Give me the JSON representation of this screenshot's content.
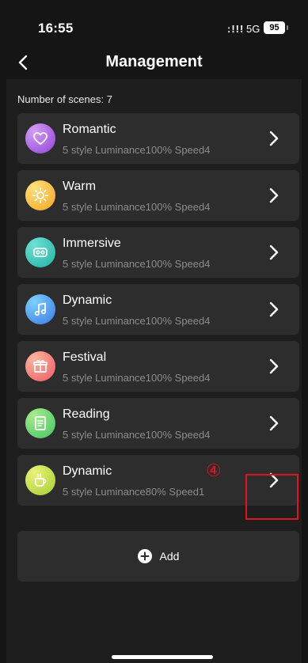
{
  "status_bar": {
    "time": "16:55",
    "signal": ":!!!",
    "network": "5G",
    "battery": "95"
  },
  "header": {
    "title": "Management",
    "back_icon": "chevron-left-icon"
  },
  "scene_count_label": "Number of scenes: 7",
  "scenes": [
    {
      "name": "Romantic",
      "desc": "5 style Luminance100% Speed4",
      "icon": "heart-icon",
      "colors": [
        "#d69cf5",
        "#8e44d6"
      ]
    },
    {
      "name": "Warm",
      "desc": "5 style Luminance100% Speed4",
      "icon": "sun-icon",
      "colors": [
        "#fde07a",
        "#f5a623"
      ]
    },
    {
      "name": "Immersive",
      "desc": "5 style Luminance100% Speed4",
      "icon": "vr-goggles-icon",
      "colors": [
        "#6ee0d2",
        "#1fb3a6"
      ]
    },
    {
      "name": "Dynamic",
      "desc": "5 style Luminance100% Speed4",
      "icon": "music-note-icon",
      "colors": [
        "#7cd0fb",
        "#3b78e8"
      ]
    },
    {
      "name": "Festival",
      "desc": "5 style Luminance100% Speed4",
      "icon": "gift-icon",
      "colors": [
        "#fbb69d",
        "#ee5a66"
      ]
    },
    {
      "name": "Reading",
      "desc": "5 style Luminance100% Speed4",
      "icon": "book-icon",
      "colors": [
        "#a8ec8a",
        "#42c368"
      ]
    },
    {
      "name": "Dynamic",
      "desc": "5 style Luminance80% Speed1",
      "icon": "coffee-cup-icon",
      "colors": [
        "#e9f27a",
        "#a6cf2f"
      ]
    }
  ],
  "annotation": {
    "marker": "④",
    "color": "#e0141f"
  },
  "add_button": {
    "label": "Add",
    "icon": "plus-circle-icon"
  }
}
